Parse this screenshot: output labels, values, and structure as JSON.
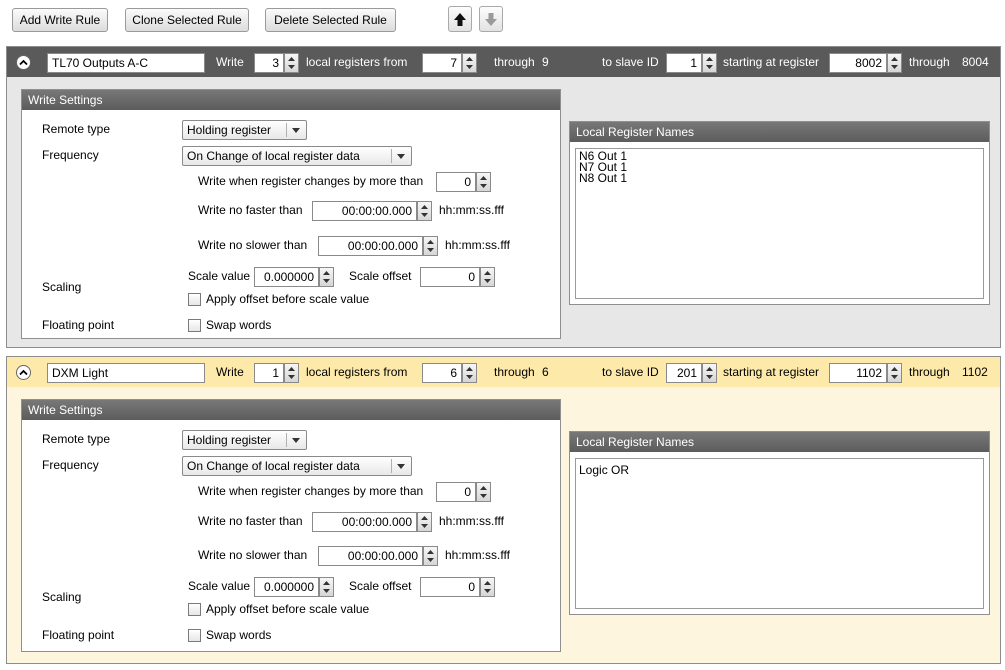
{
  "toolbar": {
    "add_label": "Add Write Rule",
    "clone_label": "Clone Selected Rule",
    "delete_label": "Delete Selected Rule"
  },
  "icons": {
    "collapse": "chevron-up-icon",
    "move_up": "arrow-up-icon",
    "move_down": "arrow-down-icon",
    "spinner": "spinner-arrows-icon",
    "dropdown": "chevron-down-icon"
  },
  "colors": {
    "rule1_header": "#5a5a5a",
    "rule1_body": "#e7e7e7",
    "rule2_header": "#fde9a9",
    "rule2_body": "#fdf5dd",
    "group_header": "#6a6a6a"
  },
  "labels": {
    "write": "Write",
    "local_registers_from": "local registers from",
    "through": "through",
    "to_slave_id": "to slave ID",
    "starting_at_register": "starting at register",
    "write_settings": "Write Settings",
    "remote_type": "Remote type",
    "frequency": "Frequency",
    "write_when_changes": "Write when register changes by more than",
    "write_no_faster": "Write no faster than",
    "write_no_slower": "Write no slower than",
    "time_units": "hh:mm:ss.fff",
    "scaling": "Scaling",
    "scale_value": "Scale value",
    "scale_offset": "Scale offset",
    "apply_offset": "Apply offset before scale value",
    "floating_point": "Floating point",
    "swap_words": "Swap words",
    "local_register_names": "Local Register Names"
  },
  "rules": [
    {
      "name": "TL70 Outputs A-C",
      "count": "3",
      "from": "7",
      "through": "9",
      "slave_id": "1",
      "start_register": "8002",
      "end_register": "8004",
      "remote_type": "Holding register",
      "frequency": "On Change of local register data",
      "change_threshold": "0",
      "no_faster": "00:00:00.000",
      "no_slower": "00:00:00.000",
      "scale_value": "0.000000",
      "scale_offset": "0",
      "apply_offset_checked": false,
      "swap_words_checked": false,
      "register_names": [
        "N6 Out 1",
        "N7 Out 1",
        "N8 Out 1"
      ]
    },
    {
      "name": "DXM Light",
      "count": "1",
      "from": "6",
      "through": "6",
      "slave_id": "201",
      "start_register": "1102",
      "end_register": "1102",
      "remote_type": "Holding register",
      "frequency": "On Change of local register data",
      "change_threshold": "0",
      "no_faster": "00:00:00.000",
      "no_slower": "00:00:00.000",
      "scale_value": "0.000000",
      "scale_offset": "0",
      "apply_offset_checked": false,
      "swap_words_checked": false,
      "register_names": [
        "Logic OR"
      ]
    }
  ]
}
